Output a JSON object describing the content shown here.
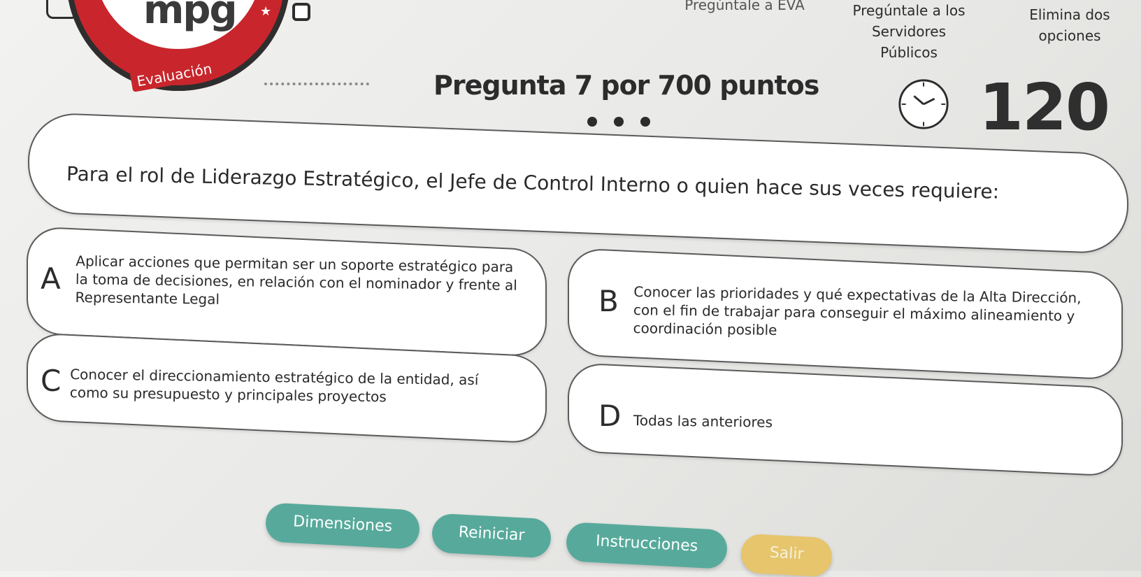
{
  "logo": {
    "text": "mpg",
    "tagline": "Evaluación",
    "star": "★"
  },
  "lifelines": {
    "ask_eva": "Pregúntale a EVA",
    "ask_public_servers": "Pregúntale a los\nServidores\nPúblicos",
    "fifty_fifty": "Elimina dos\nopciones"
  },
  "question": {
    "title": "Pregunta 7 por 700 puntos",
    "text": "Para el rol de Liderazgo Estratégico, el Jefe de Control Interno o quien hace sus veces requiere:"
  },
  "timer": {
    "value": "120"
  },
  "answers": [
    {
      "letter": "A",
      "text": "Aplicar acciones que permitan ser un soporte estratégico para la toma de decisiones, en relación con el nominador y frente al Representante Legal"
    },
    {
      "letter": "B",
      "text": "Conocer las prioridades y qué expectativas de la Alta Dirección, con el fin de trabajar para conseguir el máximo alineamiento y coordinación posible"
    },
    {
      "letter": "C",
      "text": "Conocer el direccionamiento estratégico de la entidad, así como su presupuesto y principales proyectos"
    },
    {
      "letter": "D",
      "text": "Todas las anteriores"
    }
  ],
  "buttons": {
    "dimensions": "Dimensiones",
    "reset": "Reiniciar",
    "instructions": "Instrucciones",
    "exit": "Salir"
  },
  "colors": {
    "brand_red": "#c8262c",
    "button_teal": "#57aa9b",
    "button_exit": "#e6c56c"
  }
}
